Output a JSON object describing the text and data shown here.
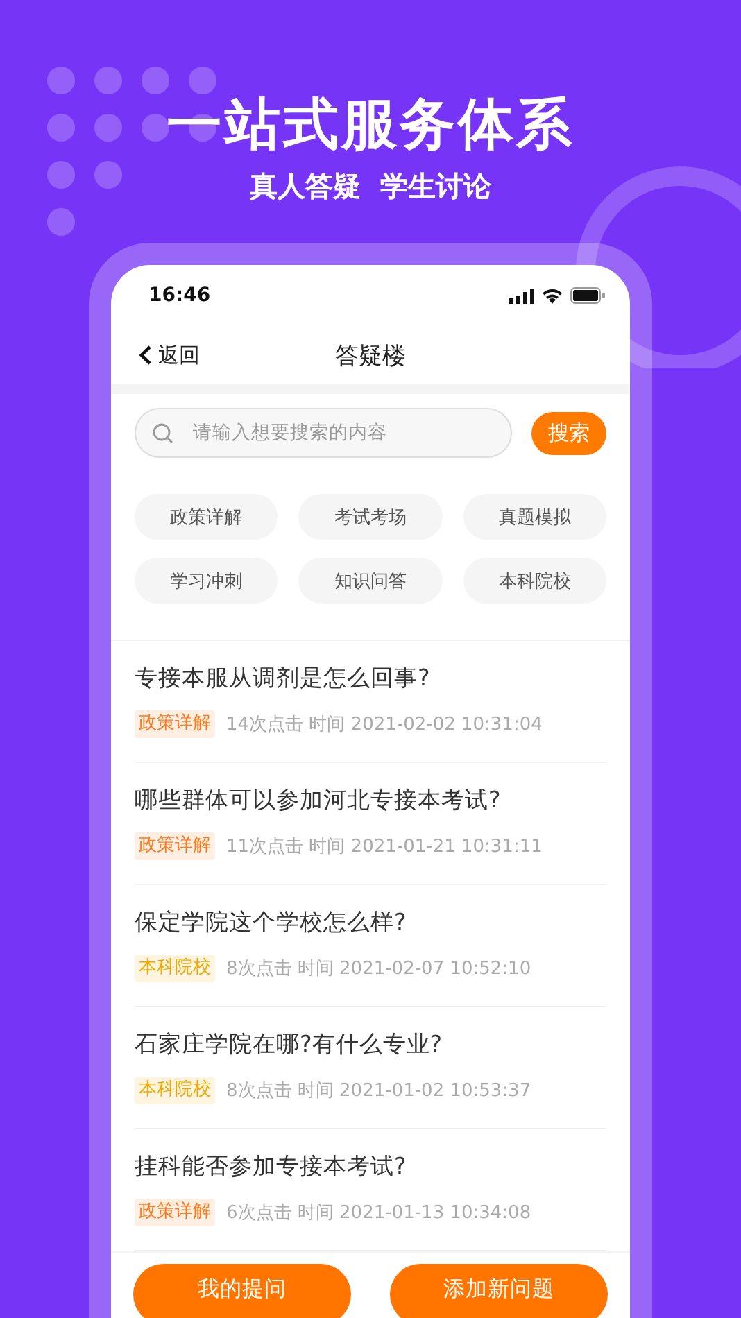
{
  "headline": "一站式服务体系",
  "subtitle": "真人答疑  学生讨论",
  "status_bar": {
    "time": "16:46"
  },
  "nav": {
    "back": "返回",
    "title": "答疑楼"
  },
  "search": {
    "placeholder": "请输入想要搜索的内容",
    "button": "搜索"
  },
  "categories": [
    "政策详解",
    "考试考场",
    "真题模拟",
    "学习冲刺",
    "知识问答",
    "本科院校"
  ],
  "questions": [
    {
      "title": "专接本服从调剂是怎么回事?",
      "tag": "政策详解",
      "color": "#ff7a1c",
      "meta": "14次点击 时间 2021-02-02 10:31:04"
    },
    {
      "title": "哪些群体可以参加河北专接本考试?",
      "tag": "政策详解",
      "color": "#ff7a1c",
      "meta": "11次点击 时间 2021-01-21 10:31:11"
    },
    {
      "title": "保定学院这个学校怎么样?",
      "tag": "本科院校",
      "color": "#f2a900",
      "meta": "8次点击 时间 2021-02-07 10:52:10"
    },
    {
      "title": "石家庄学院在哪?有什么专业?",
      "tag": "本科院校",
      "color": "#f2a900",
      "meta": "8次点击 时间 2021-01-02 10:53:37"
    },
    {
      "title": "挂科能否参加专接本考试?",
      "tag": "政策详解",
      "color": "#ff7a1c",
      "meta": "6次点击 时间 2021-01-13 10:34:08"
    }
  ],
  "buttons": [
    "我的提问",
    "添加新问题"
  ]
}
